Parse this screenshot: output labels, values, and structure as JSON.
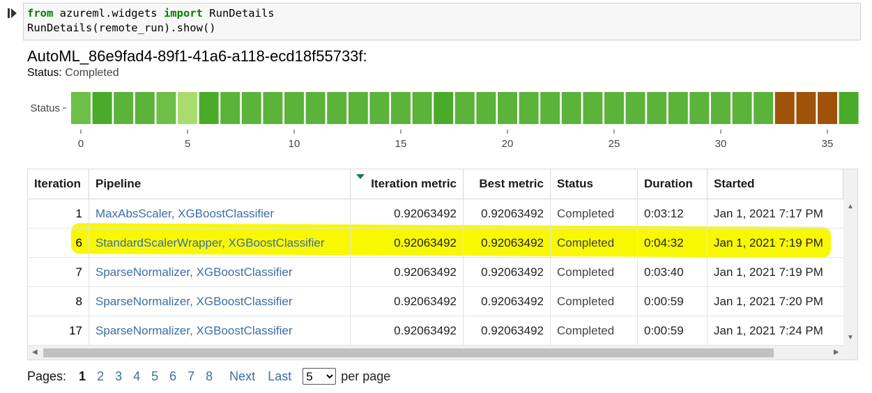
{
  "notebook": {
    "code_line1": {
      "kw1": "from",
      "mod": " azureml.widgets ",
      "kw2": "import",
      "cls": " RunDetails"
    },
    "code_line2": "RunDetails(remote_run).show()"
  },
  "run": {
    "title": "AutoML_86e9fad4-89f1-41a6-a118-ecd18f55733f:",
    "status_label": "Status:",
    "status_value": "Completed"
  },
  "chart_data": {
    "type": "heatmap",
    "ylabel": "Status",
    "x_ticks": [
      0,
      5,
      10,
      15,
      20,
      25,
      30,
      35
    ],
    "cells": [
      {
        "iteration": 0,
        "color": "#6cbf47"
      },
      {
        "iteration": 1,
        "color": "#4aaa2a"
      },
      {
        "iteration": 2,
        "color": "#5bb339"
      },
      {
        "iteration": 3,
        "color": "#5bb339"
      },
      {
        "iteration": 4,
        "color": "#6cbf47"
      },
      {
        "iteration": 5,
        "color": "#a8dc6c"
      },
      {
        "iteration": 6,
        "color": "#4aaa2a"
      },
      {
        "iteration": 7,
        "color": "#5bb339"
      },
      {
        "iteration": 8,
        "color": "#5bb339"
      },
      {
        "iteration": 9,
        "color": "#5bb339"
      },
      {
        "iteration": 10,
        "color": "#5bb339"
      },
      {
        "iteration": 11,
        "color": "#5bb339"
      },
      {
        "iteration": 12,
        "color": "#5bb339"
      },
      {
        "iteration": 13,
        "color": "#5bb339"
      },
      {
        "iteration": 14,
        "color": "#5bb339"
      },
      {
        "iteration": 15,
        "color": "#5bb339"
      },
      {
        "iteration": 16,
        "color": "#5bb339"
      },
      {
        "iteration": 17,
        "color": "#4aaa2a"
      },
      {
        "iteration": 18,
        "color": "#5bb339"
      },
      {
        "iteration": 19,
        "color": "#5bb339"
      },
      {
        "iteration": 20,
        "color": "#5bb339"
      },
      {
        "iteration": 21,
        "color": "#5bb339"
      },
      {
        "iteration": 22,
        "color": "#5bb339"
      },
      {
        "iteration": 23,
        "color": "#5bb339"
      },
      {
        "iteration": 24,
        "color": "#5bb339"
      },
      {
        "iteration": 25,
        "color": "#5bb339"
      },
      {
        "iteration": 26,
        "color": "#5bb339"
      },
      {
        "iteration": 27,
        "color": "#5bb339"
      },
      {
        "iteration": 28,
        "color": "#5bb339"
      },
      {
        "iteration": 29,
        "color": "#5bb339"
      },
      {
        "iteration": 30,
        "color": "#5bb339"
      },
      {
        "iteration": 31,
        "color": "#5bb339"
      },
      {
        "iteration": 32,
        "color": "#5bb339"
      },
      {
        "iteration": 33,
        "color": "#a0520a"
      },
      {
        "iteration": 34,
        "color": "#a0520a"
      },
      {
        "iteration": 35,
        "color": "#a0520a"
      },
      {
        "iteration": 36,
        "color": "#4aaa2a"
      }
    ]
  },
  "table": {
    "columns": [
      "Iteration",
      "Pipeline",
      "Iteration metric",
      "Best metric",
      "Status",
      "Duration",
      "Started"
    ],
    "rows": [
      {
        "iteration": "1",
        "pipeline": "MaxAbsScaler, XGBoostClassifier",
        "iteration_metric": "0.92063492",
        "best_metric": "0.92063492",
        "status": "Completed",
        "duration": "0:03:12",
        "started": "Jan 1, 2021 7:17 PM"
      },
      {
        "iteration": "6",
        "pipeline": "StandardScalerWrapper, XGBoostClassifier",
        "iteration_metric": "0.92063492",
        "best_metric": "0.92063492",
        "status": "Completed",
        "duration": "0:04:32",
        "started": "Jan 1, 2021 7:19 PM"
      },
      {
        "iteration": "7",
        "pipeline": "SparseNormalizer, XGBoostClassifier",
        "iteration_metric": "0.92063492",
        "best_metric": "0.92063492",
        "status": "Completed",
        "duration": "0:03:40",
        "started": "Jan 1, 2021 7:19 PM"
      },
      {
        "iteration": "8",
        "pipeline": "SparseNormalizer, XGBoostClassifier",
        "iteration_metric": "0.92063492",
        "best_metric": "0.92063492",
        "status": "Completed",
        "duration": "0:00:59",
        "started": "Jan 1, 2021 7:20 PM"
      },
      {
        "iteration": "17",
        "pipeline": "SparseNormalizer, XGBoostClassifier",
        "iteration_metric": "0.92063492",
        "best_metric": "0.92063492",
        "status": "Completed",
        "duration": "0:00:59",
        "started": "Jan 1, 2021 7:24 PM"
      }
    ],
    "highlight_color": "#f8f800"
  },
  "pager": {
    "label": "Pages:",
    "pages": [
      "1",
      "2",
      "3",
      "4",
      "5",
      "6",
      "7",
      "8"
    ],
    "current_page": "1",
    "next": "Next",
    "last": "Last",
    "per_page_value": "5",
    "per_page_label": "per page"
  }
}
